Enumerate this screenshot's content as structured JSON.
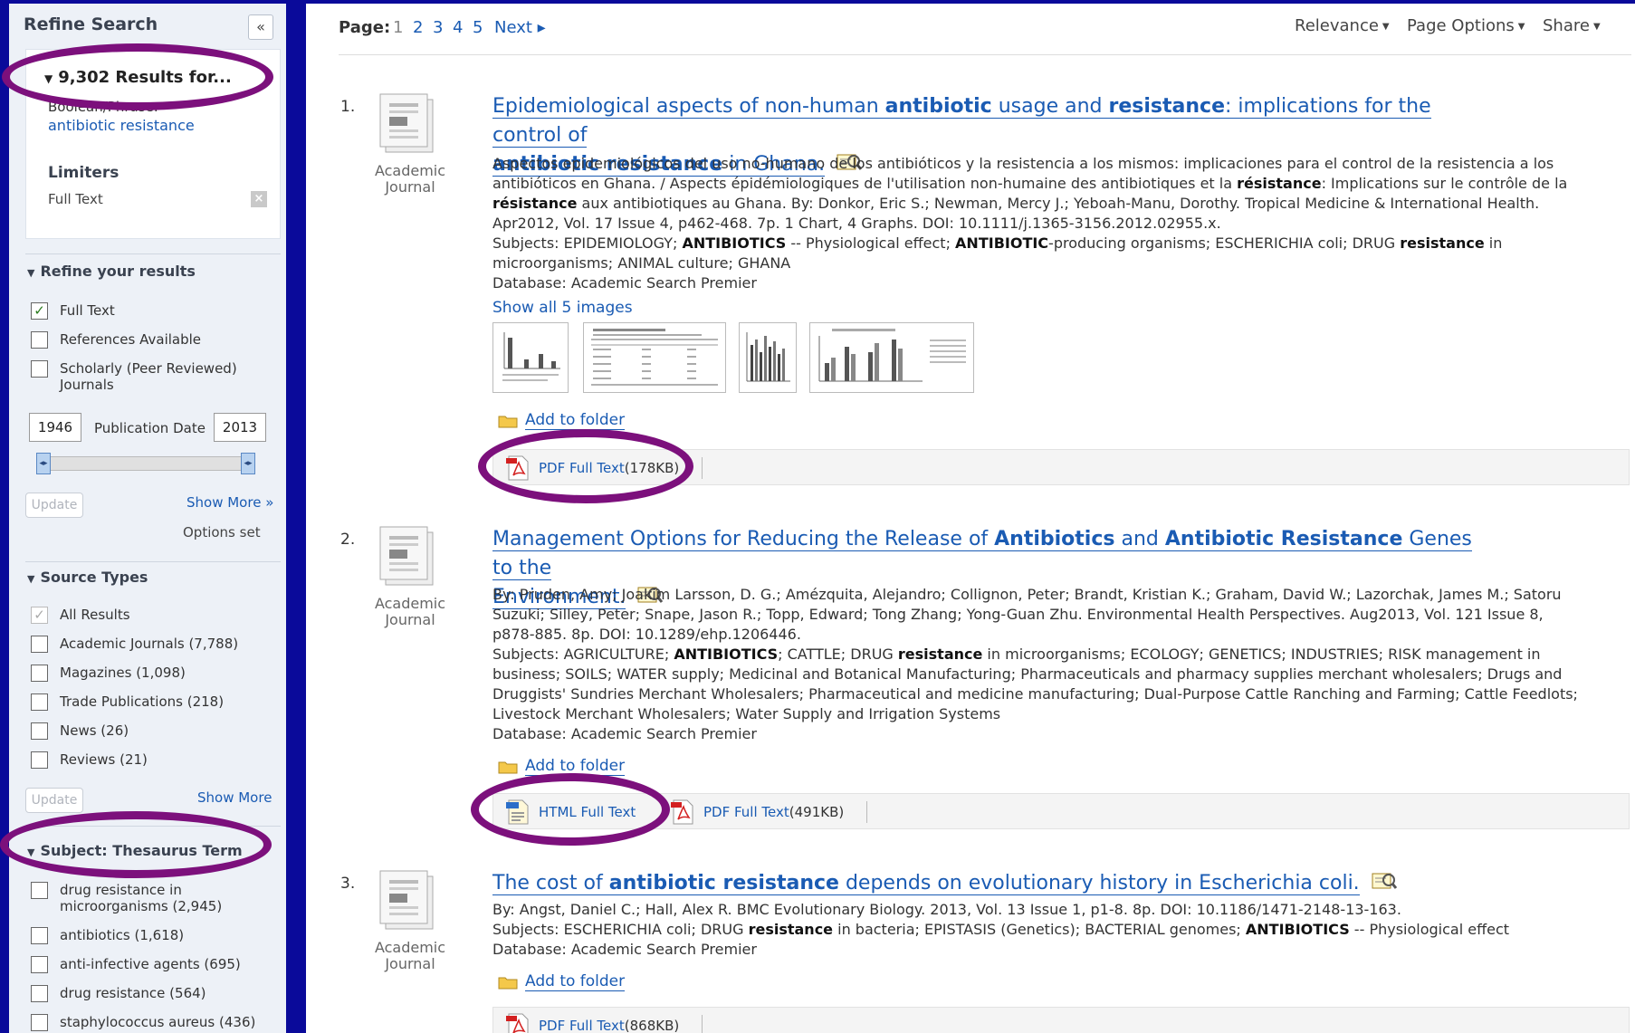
{
  "sidebar": {
    "title": "Refine Search",
    "collapse_label": "«",
    "results_header": "9,302 Results for...",
    "results_bool": "Boolean/Phrase:",
    "results_term": "antibiotic resistance",
    "limiters_heading": "Limiters",
    "limiter_fulltext": "Full Text",
    "limiter_remove": "×",
    "refine_heading": "Refine your results",
    "refine_options": [
      {
        "label": "Full Text",
        "checked": true
      },
      {
        "label": "References Available",
        "checked": false
      },
      {
        "label": "Scholarly (Peer Reviewed) Journals",
        "checked": false
      }
    ],
    "date_from": "1946",
    "date_to": "2013",
    "date_label": "Publication Date",
    "update_label": "Update",
    "show_more_label": "Show More »",
    "options_set": "Options set",
    "source_heading": "Source Types",
    "source_types": [
      {
        "label": "All Results",
        "checked": true
      },
      {
        "label": "Academic Journals (7,788)",
        "checked": false
      },
      {
        "label": "Magazines (1,098)",
        "checked": false
      },
      {
        "label": "Trade Publications (218)",
        "checked": false
      },
      {
        "label": "News (26)",
        "checked": false
      },
      {
        "label": "Reviews (21)",
        "checked": false
      }
    ],
    "update2_label": "Update",
    "show_more2_label": "Show More",
    "subject_heading": "Subject: Thesaurus Term",
    "subjects": [
      {
        "label": "drug resistance in microorganisms (2,945)"
      },
      {
        "label": "antibiotics (1,618)"
      },
      {
        "label": "anti-infective agents (695)"
      },
      {
        "label": "drug resistance (564)"
      },
      {
        "label": "staphylococcus aureus (436)"
      }
    ]
  },
  "pager": {
    "label": "Page:",
    "current": "1",
    "pages": [
      "2",
      "3",
      "4",
      "5"
    ],
    "next": "Next ▸"
  },
  "toolbar": {
    "relevance": "Relevance",
    "page_options": "Page Options",
    "share": "Share"
  },
  "results": [
    {
      "num": "1.",
      "type": "Academic Journal",
      "body_lines": [
        "Aspectos epidemiológicos del uso no-humano de los antibióticos y la resistencia a los mismos: implicaciones para el control de la resistencia a los",
        "antibióticos en Ghana. / Aspects épidémiologiques de l'utilisation non-humaine des antibiotiques et la",
        "résistance",
        ": Implications sur le contrôle de la",
        "aux antibiotiques au Ghana. By: Donkor, Eric S.; Newman, Mercy J.; Yeboah-Manu, Dorothy. Tropical Medicine & International Health.",
        "Apr2012, Vol. 17 Issue 4, p462-468. 7p. 1 Chart, 4 Graphs. DOI: 10.1111/j.1365-3156.2012.02955.x.",
        "Subjects: EPIDEMIOLOGY; ",
        "ANTIBIOTICS",
        " -- Physiological effect; ",
        "ANTIBIOTIC",
        "-producing organisms; ESCHERICHIA coli; DRUG ",
        "resistance",
        " in",
        "microorganisms; ANIMAL culture; GHANA",
        "Database: Academic Search Premier"
      ],
      "show_images": "Show all 5 images",
      "add_folder": "Add to folder",
      "pdf_label": "PDF Full Text",
      "pdf_size": "(178KB)"
    },
    {
      "num": "2.",
      "type": "Academic Journal",
      "body_lines": [
        "By: Pruden, Amy; Joakim Larsson, D. G.; Amézquita, Alejandro; Collignon, Peter; Brandt, Kristian K.; Graham, David W.; Lazorchak, James M.; Satoru",
        "Suzuki; Silley, Peter; Snape, Jason R.; Topp, Edward; Tong Zhang; Yong-Guan Zhu. Environmental Health Perspectives. Aug2013, Vol. 121 Issue 8,",
        "p878-885. 8p. DOI: 10.1289/ehp.1206446.",
        "Subjects: AGRICULTURE; ",
        "ANTIBIOTICS",
        "; CATTLE; DRUG ",
        "resistance",
        " in microorganisms; ECOLOGY; GENETICS; INDUSTRIES; RISK management in",
        "business; SOILS; WATER supply; Medicinal and Botanical Manufacturing; Pharmaceuticals and pharmacy supplies merchant wholesalers; Drugs and",
        "Druggists' Sundries Merchant Wholesalers; Pharmaceutical and medicine manufacturing; Dual-Purpose Cattle Ranching and Farming; Cattle Feedlots;",
        "Livestock Merchant Wholesalers; Water Supply and Irrigation Systems",
        "Database: Academic Search Premier"
      ],
      "add_folder": "Add to folder",
      "html_label": "HTML Full Text",
      "pdf_label": "PDF Full Text",
      "pdf_size": "(491KB)"
    },
    {
      "num": "3.",
      "type": "Academic Journal",
      "body_lines": [
        "By: Angst, Daniel C.; Hall, Alex R. BMC Evolutionary Biology. 2013, Vol. 13 Issue 1, p1-8. 8p. DOI: 10.1186/1471-2148-13-163.",
        "Subjects: ESCHERICHIA coli; DRUG ",
        "resistance",
        " in bacteria; EPISTASIS (Genetics); BACTERIAL genomes; ",
        "ANTIBIOTICS",
        " -- Physiological effect",
        "Database: Academic Search Premier"
      ],
      "add_folder": "Add to folder",
      "pdf_label": "PDF Full Text",
      "pdf_size": "(868KB)"
    }
  ],
  "titles": {
    "r1": [
      "Epidemiological aspects of non-human ",
      "antibiotic",
      " usage and ",
      "resistance",
      ": implications for the control of",
      "antibiotic resistance",
      " in Ghana."
    ],
    "r2": [
      "Management Options for Reducing the Release of ",
      "Antibiotics",
      " and ",
      "Antibiotic Resistance",
      " Genes to the",
      "Environment."
    ],
    "r3": [
      "The cost of ",
      "antibiotic resistance",
      " depends on evolutionary history in Escherichia coli."
    ]
  },
  "colors": {
    "link": "#1a5bb3",
    "annotation": "#7c107c",
    "background": "#0a0a9a"
  }
}
